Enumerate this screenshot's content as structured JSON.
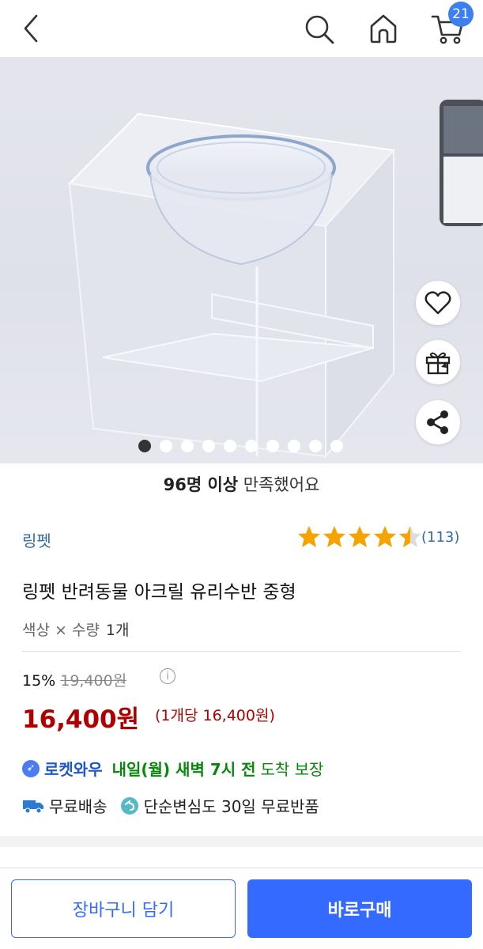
{
  "header": {
    "back_icon": "chevron-left-icon",
    "search_icon": "search-icon",
    "home_icon": "home-icon",
    "cart_icon": "cart-icon",
    "cart_count": "21"
  },
  "gallery": {
    "slide_count": 10,
    "active_index": 0,
    "side_buttons": [
      "heart-icon",
      "gift-icon",
      "share-icon"
    ]
  },
  "satisfaction": {
    "count_text": "96명 이상",
    "rest_text": " 만족했어요"
  },
  "product": {
    "brand": "링펫",
    "rating": 4.5,
    "review_count": "(113)",
    "title": "링펫 반려동물 아크릴 유리수반 중형",
    "option_label": "색상 × 수량",
    "option_value": "1개"
  },
  "pricing": {
    "discount": "15%",
    "original_price": "19,400원",
    "sale_price": "16,400원",
    "unit_price": "(1개당 16,400원)"
  },
  "delivery": {
    "rocket_name": "로켓와우",
    "arrival_time": "내일(월) 새벽 7시 전",
    "guarantee": "도착 보장",
    "free_shipping": "무료배송",
    "free_return": "단순변심도 30일 무료반품"
  },
  "actions": {
    "cart_button": "장바구니 담기",
    "buy_button": "바로구매"
  },
  "colors": {
    "accent": "#346aff",
    "price": "#ae0000",
    "rocket_green": "#07880b",
    "brand_blue": "#346aa8"
  }
}
